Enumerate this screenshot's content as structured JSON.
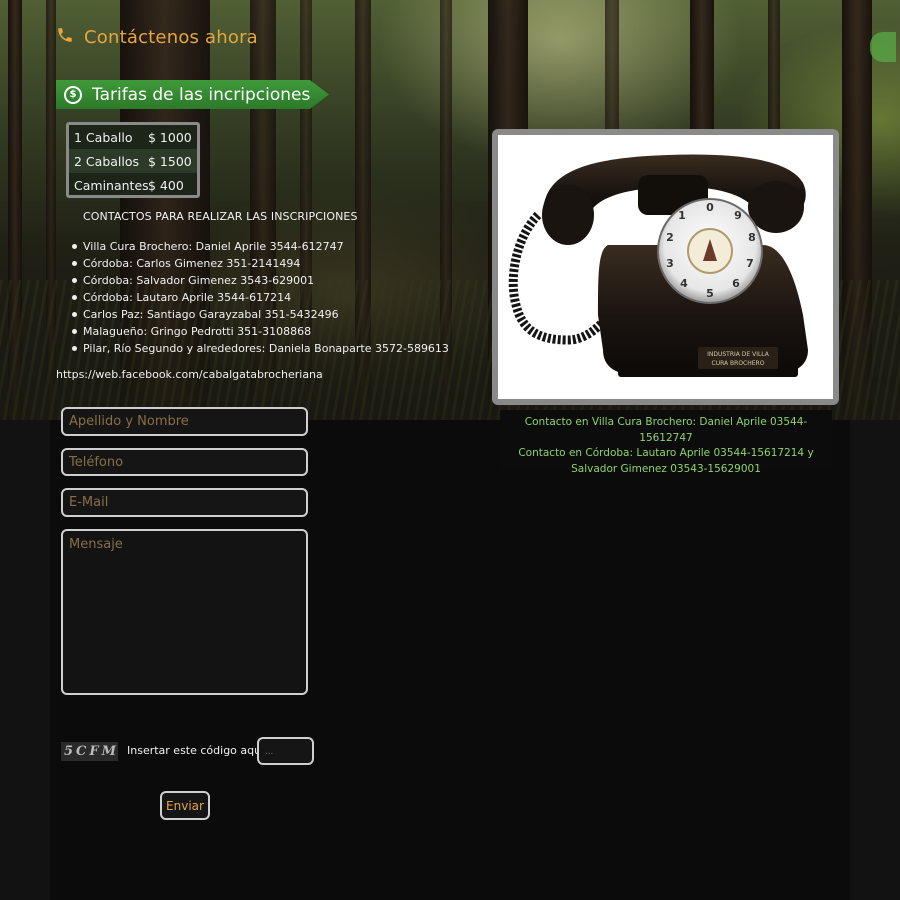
{
  "header": {
    "contact_title": "Contáctenos ahora",
    "icon": "phone-icon",
    "accent_color": "#e4a640"
  },
  "rates": {
    "title": "Tarifas de las incripciones",
    "icon": "dollar-circle-icon",
    "rows": [
      {
        "label": "1 Caballo",
        "price": "$ 1000"
      },
      {
        "label": "2 Caballos",
        "price": "$ 1500"
      },
      {
        "label": "Caminantes",
        "price": "$ 400"
      }
    ]
  },
  "contacts": {
    "heading": "CONTACTOS PARA REALIZAR LAS INSCRIPCIONES",
    "items": [
      "Villa Cura Brochero: Daniel Aprile 3544-612747",
      "Córdoba: Carlos Gimenez 351-2141494",
      "Córdoba: Salvador Gimenez 3543-629001",
      "Córdoba: Lautaro Aprile 3544-617214",
      "Carlos Paz: Santiago Garayzabal 351-5432496",
      "Malagueño: Gringo Pedrotti 351-3108868",
      "Pilar, Río Segundo y alrededores: Daniela Bonaparte 3572-589613"
    ],
    "facebook": "https://web.facebook.com/cabalgatabrocheriana"
  },
  "photo": {
    "plate_line1": "INDUSTRIA DE VILLA",
    "plate_line2": "CURA BROCHERO"
  },
  "caption": {
    "line1": "Contacto en Villa Cura Brochero: Daniel Aprile 03544-15612747",
    "line2": "Contacto en Córdoba: Lautaro Aprile 03544-15617214 y Salvador Gimenez 03543-15629001"
  },
  "form": {
    "name_placeholder": "Apellido y Nombre",
    "phone_placeholder": "Teléfono",
    "email_placeholder": "E-Mail",
    "message_placeholder": "Mensaje",
    "captcha_code": "5CFM",
    "captcha_label": "Insertar este código aquí:",
    "captcha_placeholder": "...",
    "submit_label": "Enviar"
  }
}
